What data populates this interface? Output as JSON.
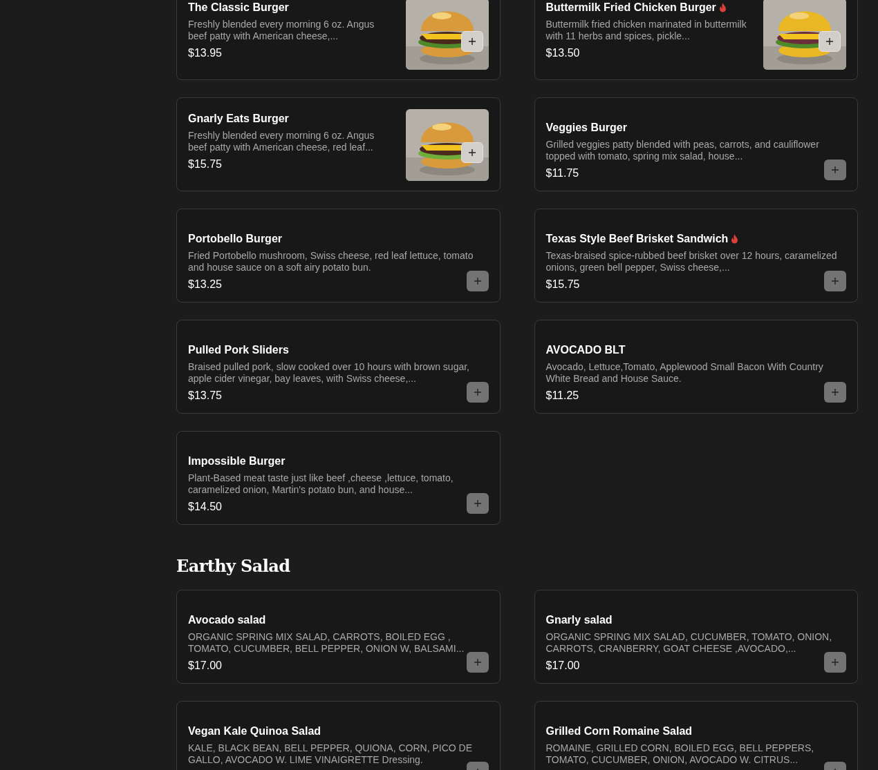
{
  "sections": [
    {
      "items": [
        {
          "name": "The Classic Burger",
          "spicy": false,
          "description": "Freshly blended every morning 6 oz. Angus beef patty with American cheese,...",
          "price": "$13.95"
        },
        {
          "name": "Buttermilk Fried Chicken Burger",
          "spicy": true,
          "description": "Buttermilk fried chicken marinated in buttermilk with 11 herbs and spices, pickle...",
          "price": "$13.50"
        },
        {
          "name": "Gnarly Eats Burger",
          "spicy": false,
          "description": "Freshly blended every morning 6 oz. Angus beef patty with American cheese, red leaf...",
          "price": "$15.75"
        },
        {
          "name": "Veggies Burger",
          "spicy": false,
          "description": "Grilled veggies patty blended with peas, carrots, and cauliflower topped with tomato, spring mix salad, house...",
          "price": "$11.75"
        },
        {
          "name": "Portobello Burger",
          "spicy": false,
          "description": "Fried Portobello mushroom, Swiss cheese, red leaf lettuce, tomato and house sauce on a soft airy potato bun.",
          "price": "$13.25"
        },
        {
          "name": "Texas Style Beef Brisket Sandwich",
          "spicy": true,
          "description": "Texas-braised spice-rubbed beef brisket over 12 hours, caramelized onions, green bell pepper, Swiss cheese,...",
          "price": "$15.75"
        },
        {
          "name": "Pulled Pork Sliders",
          "spicy": false,
          "description": "Braised pulled pork, slow cooked over 10 hours with brown sugar, apple cider vinegar, bay leaves, with Swiss cheese,...",
          "price": "$13.75"
        },
        {
          "name": "AVOCADO BLT",
          "spicy": false,
          "description": "Avocado, Lettuce,Tomato, Applewood Small Bacon With Country White Bread and House Sauce.",
          "price": "$11.25"
        },
        {
          "name": "Impossible Burger",
          "spicy": false,
          "description": "Plant-Based meat taste just like beef ,cheese ,lettuce, tomato, caramelized onion, Martin's potato bun, and house...",
          "price": "$14.50"
        }
      ]
    },
    {
      "title": "Earthy Salad",
      "items": [
        {
          "name": "Avocado salad",
          "spicy": false,
          "description": "ORGANIC SPRING MIX SALAD, CARROTS, BOILED EGG , TOMATO, CUCUMBER, BELL PEPPER, ONION W, BALSAMI...",
          "price": "$17.00"
        },
        {
          "name": "Gnarly salad",
          "spicy": false,
          "description": "ORGANIC SPRING MIX SALAD, CUCUMBER, TOMATO, ONION, CARROTS, CRANBERRY, GOAT CHEESE ,AVOCADO,...",
          "price": "$17.00"
        },
        {
          "name": "Vegan Kale Quinoa Salad",
          "spicy": false,
          "description": "KALE, BLACK BEAN, BELL PEPPER, QUIONA, CORN, PICO DE GALLO, AVOCADO W. LIME VINAIGRETTE Dressing."
        },
        {
          "name": "Grilled Corn Romaine Salad",
          "spicy": false,
          "description": "ROMAINE, GRILLED CORN, BOILED EGG, BELL PEPPERS, TOMATO, CUCUMBER, ONION, AVOCADO W. CITRUS..."
        }
      ]
    }
  ]
}
